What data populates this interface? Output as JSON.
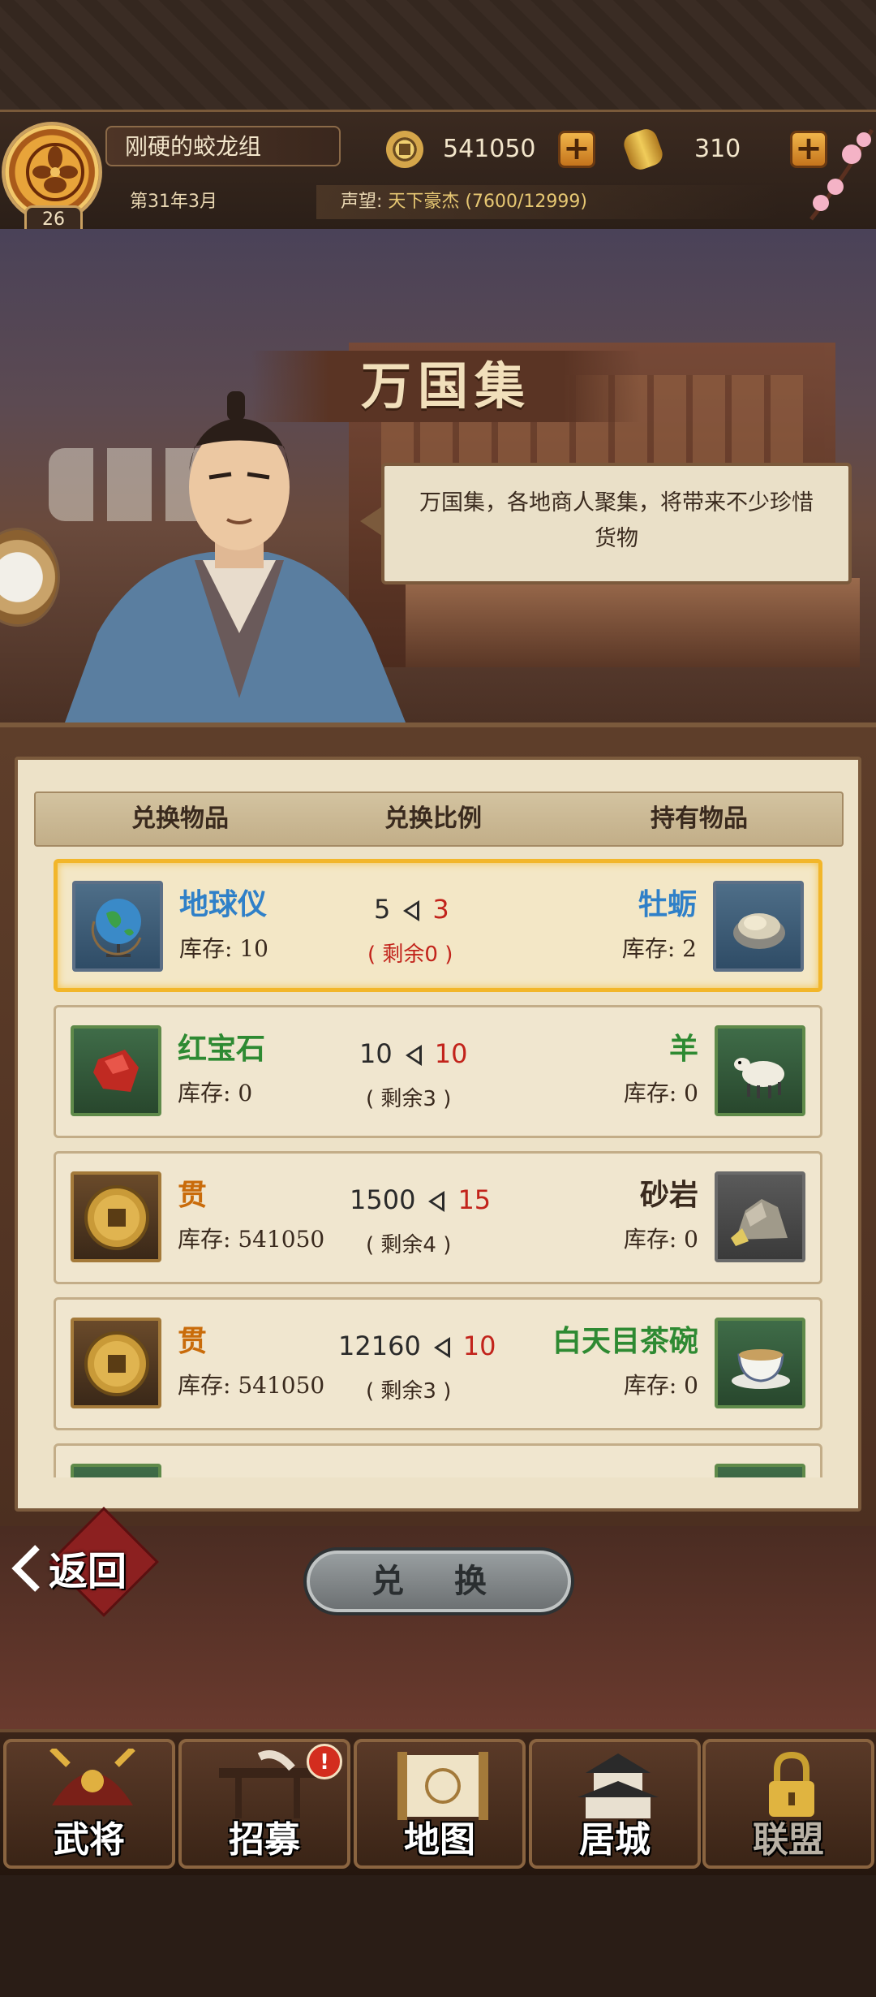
{
  "player": {
    "name": "刚硬的蛟龙组",
    "level": "26",
    "date": "第31年3月",
    "fame_label": "声望:",
    "fame_value": "天下豪杰 (7600/12999)"
  },
  "currencies": {
    "coins": "541050",
    "gold": "310",
    "plus": "+"
  },
  "scene": {
    "title": "万国集",
    "speech": "万国集，各地商人聚集，将带来不少珍惜货物"
  },
  "table": {
    "headers": [
      "兑换物品",
      "兑换比例",
      "持有物品"
    ],
    "rows": [
      {
        "give_name": "地球仪",
        "give_stock": "库存: 10",
        "ratio_left": "5",
        "ratio_right": "3",
        "remain": "( 剩余0 )",
        "get_name": "牡蛎",
        "get_stock": "库存: 2",
        "give_icon": "globe-icon",
        "get_icon": "oyster-icon"
      },
      {
        "give_name": "红宝石",
        "give_stock": "库存: 0",
        "ratio_left": "10",
        "ratio_right": "10",
        "remain": "( 剩余3 )",
        "get_name": "羊",
        "get_stock": "库存: 0",
        "give_icon": "ruby-icon",
        "get_icon": "sheep-icon"
      },
      {
        "give_name": "贯",
        "give_stock": "库存: 541050",
        "ratio_left": "1500",
        "ratio_right": "15",
        "remain": "( 剩余4 )",
        "get_name": "砂岩",
        "get_stock": "库存: 0",
        "give_icon": "coin-icon",
        "get_icon": "sandstone-icon"
      },
      {
        "give_name": "贯",
        "give_stock": "库存: 541050",
        "ratio_left": "12160",
        "ratio_right": "10",
        "remain": "( 剩余3 )",
        "get_name": "白天目茶碗",
        "get_stock": "库存: 0",
        "give_icon": "coin-icon",
        "get_icon": "tea-bowl-icon"
      }
    ]
  },
  "actions": {
    "back": "返回",
    "exchange": "兑 换"
  },
  "nav": {
    "items": [
      {
        "label": "武将",
        "icon": "samurai-helmet-icon"
      },
      {
        "label": "招募",
        "icon": "recruit-scroll-icon",
        "badge": "!"
      },
      {
        "label": "地图",
        "icon": "map-scroll-icon"
      },
      {
        "label": "居城",
        "icon": "castle-icon"
      },
      {
        "label": "联盟",
        "icon": "lock-icon",
        "locked": true
      }
    ]
  },
  "colors": {
    "selected_border": "#f2b62a",
    "ratio_red": "#c2231b",
    "name_blue": "#2f80c8",
    "name_green": "#2e8a32",
    "name_orange": "#c96b0a"
  }
}
